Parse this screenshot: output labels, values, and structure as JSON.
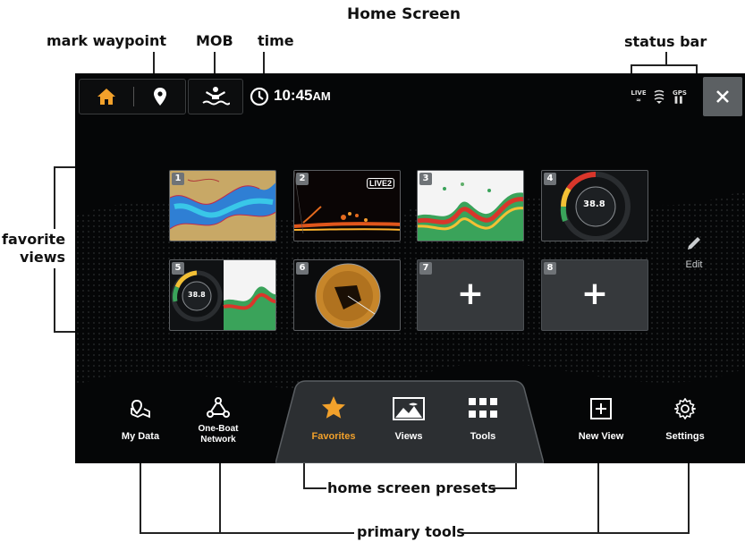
{
  "callouts": {
    "title": "Home Screen",
    "mark_waypoint": "mark waypoint",
    "mob": "MOB",
    "time": "time",
    "status_bar": "status bar",
    "favorite_views": "favorite\nviews",
    "home_screen_presets": "home screen presets",
    "primary_tools": "primary tools"
  },
  "topbar": {
    "time": "10:45",
    "ampm": "AM"
  },
  "status_icons": [
    "live-icon",
    "sonar-icon",
    "gps-icon"
  ],
  "status_text": {
    "live": "LIVE",
    "gps": "GPS"
  },
  "tiles": [
    {
      "num": "1"
    },
    {
      "num": "2",
      "badge": "LIVE2"
    },
    {
      "num": "3"
    },
    {
      "num": "4",
      "gauge": "38.8"
    },
    {
      "num": "5",
      "gauge": "38.8"
    },
    {
      "num": "6"
    },
    {
      "num": "7",
      "plus": "+"
    },
    {
      "num": "8",
      "plus": "+"
    }
  ],
  "edit_label": "Edit",
  "tray": {
    "my_data": "My Data",
    "one_boat": "One-Boat\nNetwork",
    "favorites": "Favorites",
    "views": "Views",
    "tools": "Tools",
    "new_view": "New View",
    "settings": "Settings"
  },
  "colors": {
    "accent": "#f2a12b",
    "screen_bg": "#050607",
    "tile_empty": "#36393c",
    "close_button": "#5c6063"
  }
}
